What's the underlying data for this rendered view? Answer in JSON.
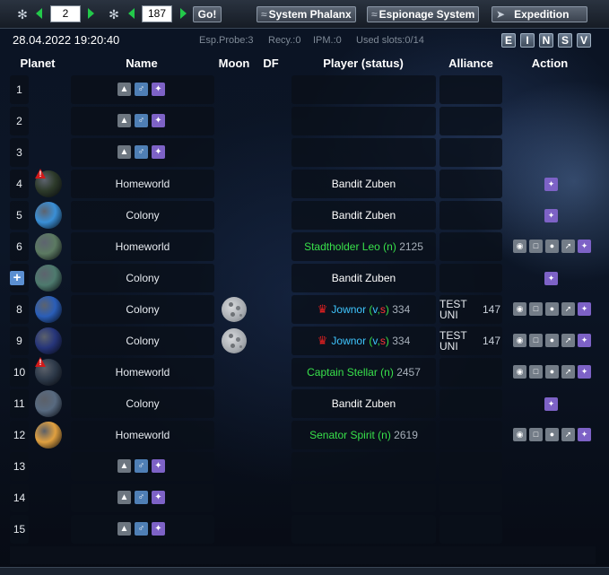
{
  "toolbar": {
    "galaxy": "2",
    "system": "187",
    "go_label": "Go!",
    "system_phalanx": "System Phalanx",
    "espionage_system": "Espionage System",
    "expedition": "Expedition"
  },
  "info": {
    "datetime": "28.04.2022 19:20:40",
    "esp_probe": "Esp.Probe:3",
    "recy": "Recy.:0",
    "ipm": "IPM.:0",
    "used_slots": "Used slots:0/14",
    "filters": [
      "E",
      "I",
      "N",
      "S",
      "V"
    ]
  },
  "headers": {
    "planet": "Planet",
    "name": "Name",
    "moon": "Moon",
    "df": "DF",
    "player": "Player (status)",
    "alliance": "Alliance",
    "action": "Action"
  },
  "rows": [
    {
      "pos": "1",
      "name": "",
      "player": "",
      "player_color": "white",
      "status": "",
      "score": "",
      "alliance": "",
      "alliance_num": "",
      "moon": false,
      "empty": true
    },
    {
      "pos": "2",
      "name": "",
      "player": "",
      "player_color": "white",
      "status": "",
      "score": "",
      "alliance": "",
      "alliance_num": "",
      "moon": false,
      "empty": true
    },
    {
      "pos": "3",
      "name": "",
      "player": "",
      "player_color": "white",
      "status": "",
      "score": "",
      "alliance": "",
      "alliance_num": "",
      "moon": false,
      "empty": true
    },
    {
      "pos": "4",
      "name": "Homeworld",
      "player": "Bandit Zuben",
      "player_color": "white",
      "status": "",
      "score": "",
      "alliance": "",
      "alliance_num": "",
      "moon": false,
      "warn": true,
      "planet_color": "#2d3a2a",
      "action": "spy"
    },
    {
      "pos": "5",
      "name": "Colony",
      "player": "Bandit Zuben",
      "player_color": "white",
      "status": "",
      "score": "",
      "alliance": "",
      "alliance_num": "",
      "moon": false,
      "planet_color": "#3a8fd6",
      "action": "spy"
    },
    {
      "pos": "6",
      "name": "Homeworld",
      "player": "Stadtholder Leo",
      "player_color": "green",
      "status": "(n)",
      "score": "2125",
      "alliance": "",
      "alliance_num": "",
      "moon": false,
      "planet_color": "#5c7a62",
      "action": "full"
    },
    {
      "pos": "7",
      "name": "Colony",
      "player": "Bandit Zuben",
      "player_color": "white",
      "status": "",
      "score": "",
      "alliance": "",
      "alliance_num": "",
      "moon": false,
      "plus": true,
      "planet_color": "#4e7a6e",
      "action": "spy"
    },
    {
      "pos": "8",
      "name": "Colony",
      "player": "Jownor",
      "player_color": "cyan",
      "status": "(v,s)",
      "score": "334",
      "alliance": "TEST UNI",
      "alliance_num": "147",
      "moon": true,
      "emblem": true,
      "planet_color": "#2a5eb8",
      "action": "full"
    },
    {
      "pos": "9",
      "name": "Colony",
      "player": "Jownor",
      "player_color": "cyan",
      "status": "(v,s)",
      "score": "334",
      "alliance": "TEST UNI",
      "alliance_num": "147",
      "moon": true,
      "emblem": true,
      "planet_color": "#26357a",
      "action": "full"
    },
    {
      "pos": "10",
      "name": "Homeworld",
      "player": "Captain Stellar",
      "player_color": "green",
      "status": "(n)",
      "score": "2457",
      "alliance": "",
      "alliance_num": "",
      "moon": false,
      "warn": true,
      "planet_color": "#2e3a4a",
      "action": "full"
    },
    {
      "pos": "11",
      "name": "Colony",
      "player": "Bandit Zuben",
      "player_color": "white",
      "status": "",
      "score": "",
      "alliance": "",
      "alliance_num": "",
      "moon": false,
      "planet_color": "#586a80",
      "action": "spy"
    },
    {
      "pos": "12",
      "name": "Homeworld",
      "player": "Senator Spirit",
      "player_color": "green",
      "status": "(n)",
      "score": "2619",
      "alliance": "",
      "alliance_num": "",
      "moon": false,
      "planet_color": "#e0a040",
      "action": "full"
    },
    {
      "pos": "13",
      "name": "",
      "player": "",
      "player_color": "white",
      "status": "",
      "score": "",
      "alliance": "",
      "alliance_num": "",
      "moon": false,
      "empty": true
    },
    {
      "pos": "14",
      "name": "",
      "player": "",
      "player_color": "white",
      "status": "",
      "score": "",
      "alliance": "",
      "alliance_num": "",
      "moon": false,
      "empty": true
    },
    {
      "pos": "15",
      "name": "",
      "player": "",
      "player_color": "white",
      "status": "",
      "score": "",
      "alliance": "",
      "alliance_num": "",
      "moon": false,
      "empty": true
    }
  ],
  "colors": {
    "accent_green": "#23c94a",
    "player_green": "#38e04a",
    "player_cyan": "#3fc6ff",
    "status_red": "#ff3434",
    "action_purple": "#7d62c6"
  }
}
